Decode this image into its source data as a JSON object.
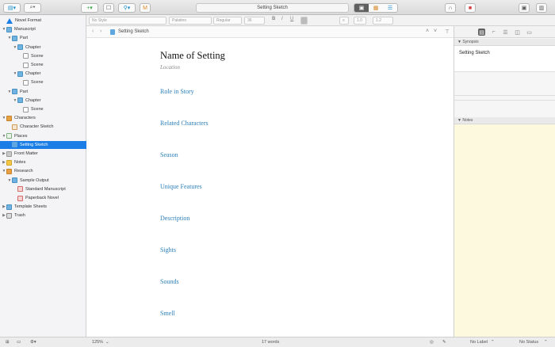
{
  "toolbar": {
    "title": "Setting Sketch",
    "binder_toggle_icon": "sidebar-icon",
    "search_icon": "magnifier-icon",
    "add_icon": "plus-icon",
    "trash_icon": "delete-icon",
    "compile_icon": "compile-icon"
  },
  "format_bar": {
    "style": "No Style",
    "font": "Palatino",
    "weight": "Regular",
    "size": "36",
    "bold": "B",
    "italic": "I",
    "underline": "U",
    "spacing": "1.0",
    "line": "1.2"
  },
  "binder": {
    "items": [
      {
        "label": "Novel Format",
        "indent": 0,
        "tri": "",
        "icon": "novel"
      },
      {
        "label": "Manuscript",
        "indent": 0,
        "tri": "▼",
        "icon": "folder"
      },
      {
        "label": "Part",
        "indent": 1,
        "tri": "▼",
        "icon": "folder"
      },
      {
        "label": "Chapter",
        "indent": 2,
        "tri": "▼",
        "icon": "folder"
      },
      {
        "label": "Scene",
        "indent": 3,
        "tri": "",
        "icon": "doc"
      },
      {
        "label": "Scene",
        "indent": 3,
        "tri": "",
        "icon": "doc"
      },
      {
        "label": "Chapter",
        "indent": 2,
        "tri": "▼",
        "icon": "folder"
      },
      {
        "label": "Scene",
        "indent": 3,
        "tri": "",
        "icon": "doc"
      },
      {
        "label": "Part",
        "indent": 1,
        "tri": "▼",
        "icon": "folder"
      },
      {
        "label": "Chapter",
        "indent": 2,
        "tri": "▼",
        "icon": "folder"
      },
      {
        "label": "Scene",
        "indent": 3,
        "tri": "",
        "icon": "doc"
      },
      {
        "label": "Characters",
        "indent": 0,
        "tri": "▼",
        "icon": "orange"
      },
      {
        "label": "Character Sketch",
        "indent": 1,
        "tri": "",
        "icon": "char"
      },
      {
        "label": "Places",
        "indent": 0,
        "tri": "▼",
        "icon": "place"
      },
      {
        "label": "Setting Sketch",
        "indent": 1,
        "tri": "",
        "icon": "text",
        "selected": true
      },
      {
        "label": "Front Matter",
        "indent": 0,
        "tri": "▶",
        "icon": "gray"
      },
      {
        "label": "Notes",
        "indent": 0,
        "tri": "▶",
        "icon": "yellow"
      },
      {
        "label": "Research",
        "indent": 0,
        "tri": "▼",
        "icon": "orange"
      },
      {
        "label": "Sample Output",
        "indent": 1,
        "tri": "▼",
        "icon": "folder"
      },
      {
        "label": "Standard Manuscript",
        "indent": 2,
        "tri": "",
        "icon": "red"
      },
      {
        "label": "Paperback Novel",
        "indent": 2,
        "tri": "",
        "icon": "red"
      },
      {
        "label": "Template Sheets",
        "indent": 0,
        "tri": "▶",
        "icon": "folder"
      },
      {
        "label": "Trash",
        "indent": 0,
        "tri": "▶",
        "icon": "trash"
      }
    ]
  },
  "editor": {
    "doc_title": "Setting Sketch",
    "page_title": "Name of Setting",
    "page_subtitle": "Location",
    "headings": [
      "Role in Story",
      "Related Characters",
      "Season",
      "Unique Features",
      "Description",
      "Sights",
      "Sounds",
      "Smell"
    ]
  },
  "inspector": {
    "synopsis_header": "Synopsis",
    "synopsis_text": "Setting Sketch",
    "notes_header": "Notes"
  },
  "footer": {
    "zoom": "125%",
    "word_count": "17 words",
    "label": "No Label",
    "status": "No Status"
  }
}
